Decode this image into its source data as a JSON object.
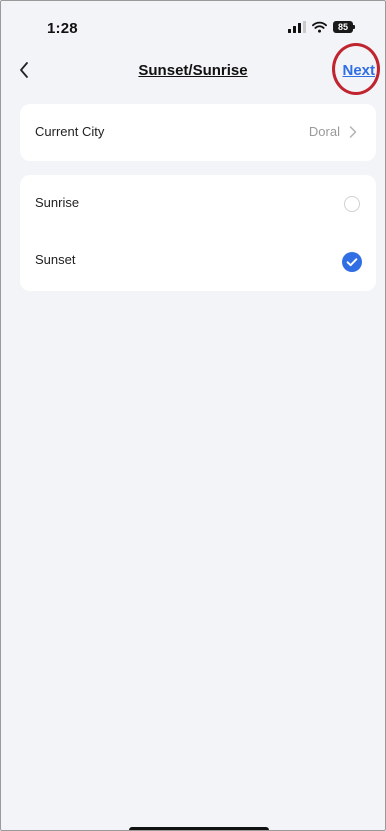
{
  "status_bar": {
    "time": "1:28",
    "battery": "85"
  },
  "nav": {
    "title": "Sunset/Sunrise",
    "next_label": "Next"
  },
  "city_card": {
    "label": "Current City",
    "value": "Doral"
  },
  "options": [
    {
      "label": "Sunrise",
      "selected": false
    },
    {
      "label": "Sunset",
      "selected": true
    }
  ],
  "colors": {
    "accent": "#2f6ee3",
    "highlight_ring": "#c0242e",
    "background": "#f3f4f8",
    "card": "#ffffff"
  },
  "icons": {
    "back": "chevron-left-icon",
    "city_disclosure": "chevron-right-icon",
    "selected": "checkmark-circle-icon",
    "unselected": "radio-empty-icon"
  }
}
